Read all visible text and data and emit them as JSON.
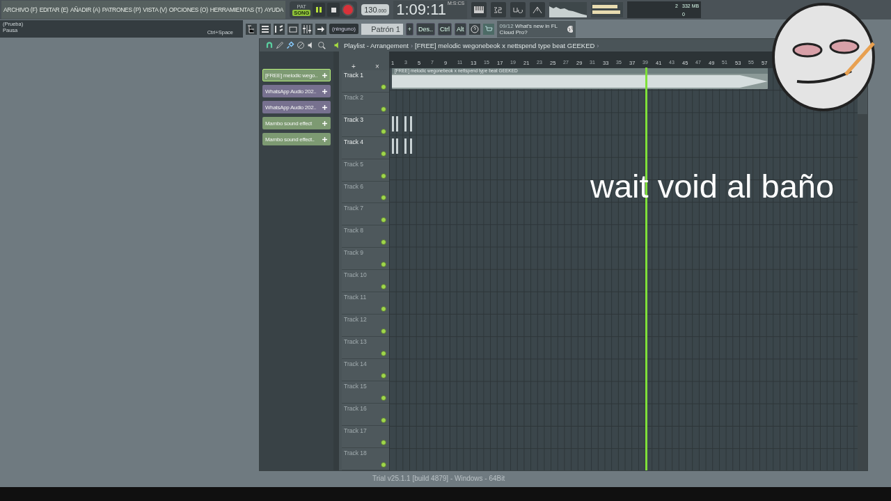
{
  "menu": [
    "ARCHIVO (F)",
    "EDITAR (E)",
    "AÑADIR (A)",
    "PATRONES (P)",
    "VISTA (V)",
    "OPCIONES (O)",
    "HERRAMIENTAS (T)",
    "AYUDA"
  ],
  "transport": {
    "modes": [
      {
        "label": "PAT",
        "selected": false
      },
      {
        "label": "SONG",
        "selected": true
      }
    ],
    "tempo": "130",
    "tempo_decimals": ".000",
    "time": "1:09:11",
    "time_format": "M:S:CS"
  },
  "monitor": {
    "cpu": "2",
    "memory": "332 MB",
    "voices": "0"
  },
  "hint": {
    "title": "(Prueba)",
    "text": "Pausa",
    "shortcut": "Ctrl+Space"
  },
  "pattern_bar": {
    "preset": "(ninguno)",
    "pattern": "Patrón 1",
    "add": "+",
    "keys": [
      "Des..",
      "Ctrl",
      "Alt"
    ]
  },
  "news": {
    "date": "09/12",
    "text": "What's new in FL Cloud Pro?"
  },
  "playlist": {
    "title": "Playlist - Arrangement",
    "separator": "›",
    "song": "[FREE] melodic wegonebeok x nettspend type beat GEEKED",
    "end_arrow": "›",
    "header_buttons": [
      "+",
      "×"
    ],
    "clips": [
      {
        "name": "[FREE] melodic wego..",
        "color": "#7d9a72",
        "selected": true
      },
      {
        "name": "WhatsApp Audio 202..",
        "color": "#77718f",
        "selected": false
      },
      {
        "name": "WhatsApp Audio 202..",
        "color": "#77718f",
        "selected": false
      },
      {
        "name": "Mambo sound effect",
        "color": "#7d9a72",
        "selected": false
      },
      {
        "name": "Mambo sound effect..",
        "color": "#7d9a72",
        "selected": false
      }
    ],
    "ruler": [
      "1",
      "3",
      "5",
      "7",
      "9",
      "11",
      "13",
      "15",
      "17",
      "19",
      "21",
      "23",
      "25",
      "27",
      "29",
      "31",
      "33",
      "35",
      "37",
      "39",
      "41",
      "43",
      "45",
      "47",
      "49",
      "51",
      "53",
      "55",
      "57"
    ],
    "tracks": [
      {
        "name": "Track 1",
        "kind": "audio",
        "clip_label": "[FREE] melodic wegonebeok x nettspend type beat GEEKED"
      },
      {
        "name": "Track 2",
        "kind": "empty"
      },
      {
        "name": "Track 3",
        "kind": "clips"
      },
      {
        "name": "Track 4",
        "kind": "clips"
      },
      {
        "name": "Track 5",
        "kind": "empty"
      },
      {
        "name": "Track 6",
        "kind": "empty"
      },
      {
        "name": "Track 7",
        "kind": "empty"
      },
      {
        "name": "Track 8",
        "kind": "empty"
      },
      {
        "name": "Track 9",
        "kind": "empty"
      },
      {
        "name": "Track 10",
        "kind": "empty"
      },
      {
        "name": "Track 11",
        "kind": "empty"
      },
      {
        "name": "Track 12",
        "kind": "empty"
      },
      {
        "name": "Track 13",
        "kind": "empty"
      },
      {
        "name": "Track 14",
        "kind": "empty"
      },
      {
        "name": "Track 15",
        "kind": "empty"
      },
      {
        "name": "Track 16",
        "kind": "empty"
      },
      {
        "name": "Track 17",
        "kind": "empty"
      },
      {
        "name": "Track 18",
        "kind": "empty"
      }
    ]
  },
  "status": "Trial v25.1.1 [build 4879] - Windows - 64Bit",
  "caption": "wait void al baño"
}
